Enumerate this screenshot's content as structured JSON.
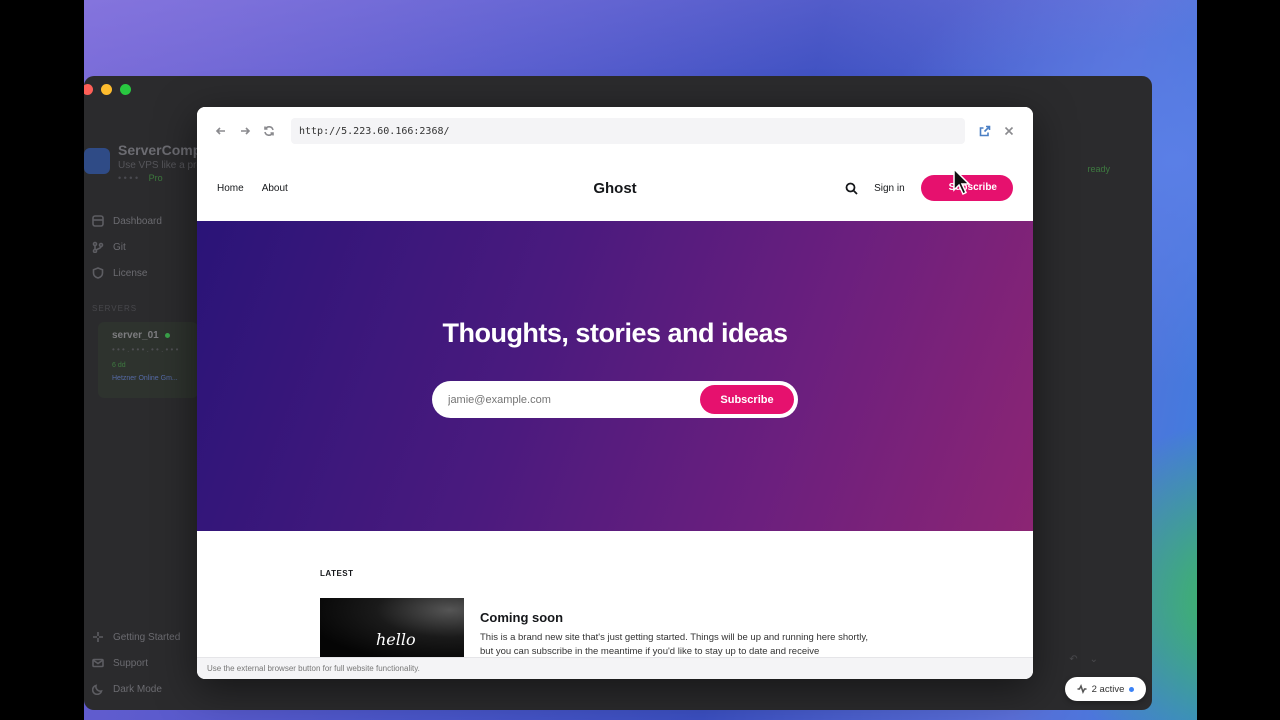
{
  "app": {
    "name": "ServerCompass",
    "subtitle": "Use VPS like a pro",
    "plan": "Pro",
    "status": "ready",
    "nav": [
      "Dashboard",
      "Git",
      "License"
    ],
    "section_label": "SERVERS",
    "server": {
      "name": "server_01",
      "ip": "• • • . • • • . • • . • • •",
      "tag": "6 dd",
      "host": "Hetzner Online Gm..."
    },
    "bottom_nav": [
      "Getting Started",
      "Support",
      "Dark Mode"
    ],
    "active_pill": "2 active"
  },
  "browser": {
    "url": "http://5.223.60.166:2368/",
    "footer_note": "Use the external browser button for full website functionality."
  },
  "site": {
    "nav_links": [
      "Home",
      "About"
    ],
    "logo": "Ghost",
    "sign_in": "Sign in",
    "subscribe_top": "Subscribe",
    "hero_title": "Thoughts, stories and ideas",
    "email_placeholder": "jamie@example.com",
    "subscribe_button": "Subscribe",
    "latest_label": "LATEST",
    "post": {
      "thumb_text": "hello",
      "title": "Coming soon",
      "excerpt": "This is a brand new site that's just getting started. Things will be up and running here shortly, but you can subscribe in the meantime if you'd like to stay up to date and receive"
    }
  },
  "colors": {
    "accent": "#e6116e",
    "hero_start": "#2a1478",
    "hero_end": "#8c2574"
  }
}
